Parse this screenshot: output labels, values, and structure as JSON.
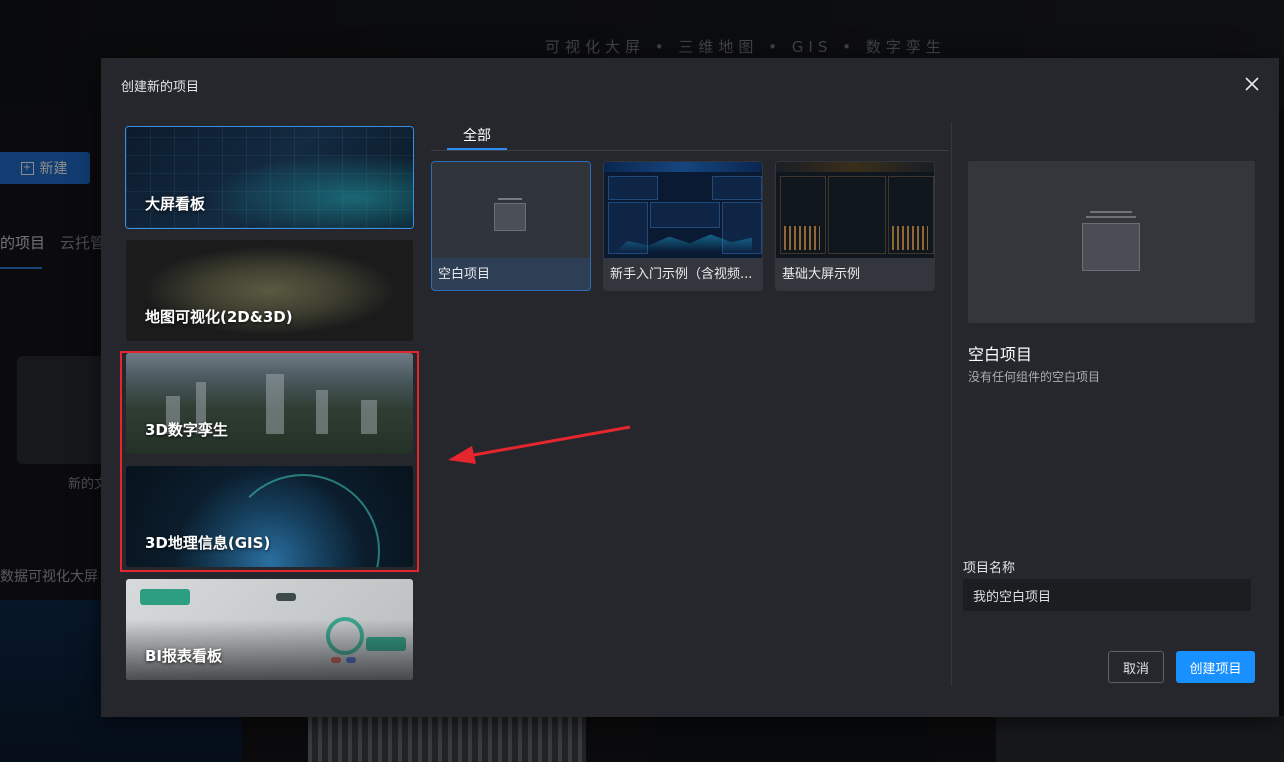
{
  "background": {
    "tagline": "可视化大屏  •  三维地图  •  GIS  •  数字孪生",
    "new_button": "新建",
    "tab_projects": "的项目",
    "tab_cloud": "云托管",
    "new_folder_label": "新的文",
    "section_title": "数据可视化大屏"
  },
  "dialog": {
    "title": "创建新的项目",
    "categories": [
      {
        "label": "大屏看板"
      },
      {
        "label": "地图可视化(2D&3D)"
      },
      {
        "label": "3D数字孪生"
      },
      {
        "label": "3D地理信息(GIS)"
      },
      {
        "label": "BI报表看板"
      }
    ],
    "tabs": [
      {
        "label": "全部"
      }
    ],
    "templates": [
      {
        "label": "空白项目"
      },
      {
        "label": "新手入门示例（含视频..."
      },
      {
        "label": "基础大屏示例"
      }
    ],
    "preview": {
      "name": "空白项目",
      "description": "没有任何组件的空白项目"
    },
    "project_name_label": "项目名称",
    "project_name_value": "我的空白项目",
    "cancel_label": "取消",
    "create_label": "创建项目"
  },
  "colors": {
    "accent": "#1890ff",
    "highlight_box": "#e5262e",
    "arrow": "#e5262e",
    "dialog_bg": "#25272c"
  }
}
